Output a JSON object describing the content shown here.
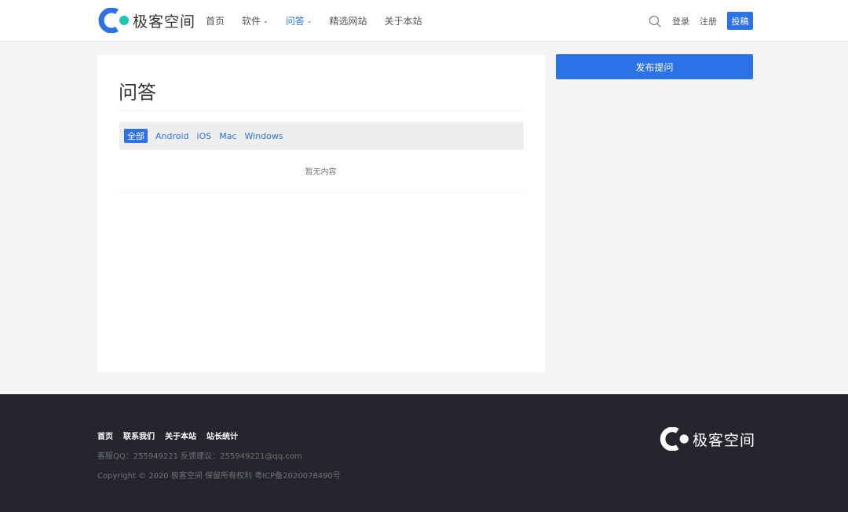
{
  "header": {
    "logo_text": "极客空间",
    "nav": [
      {
        "label": "首页"
      },
      {
        "label": "软件"
      },
      {
        "label": "问答"
      },
      {
        "label": "精选网站"
      },
      {
        "label": "关于本站"
      }
    ],
    "login_label": "登录",
    "register_label": "注册",
    "post_label": "投稿"
  },
  "main": {
    "title": "问答",
    "filters": [
      "全部",
      "Android",
      "iOS",
      "Mac",
      "Windows"
    ],
    "empty_text": "暂无内容"
  },
  "sidebar": {
    "ask_label": "发布提问"
  },
  "footer": {
    "links": [
      "首页",
      "联系我们",
      "关于本站",
      "站长统计"
    ],
    "contact": "客服QQ：255949221 反馈建议：255949221@qq.com",
    "copyright": "Copyright © 2020 极客空间 保留所有权利 粤ICP备2020078490号",
    "logo_text": "极客空间"
  },
  "colors": {
    "accent": "#2b72e6",
    "logo_dot": "#1ec3b4",
    "footer_bg": "#25262d",
    "page_bg": "#f5f5f5"
  }
}
